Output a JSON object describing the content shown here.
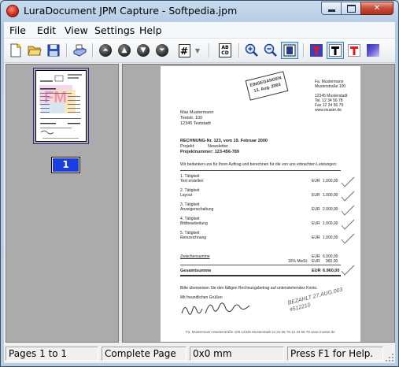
{
  "window": {
    "title": "LuraDocument JPM Capture - Softpedia.jpm"
  },
  "menu": [
    "File",
    "Edit",
    "View",
    "Settings",
    "Help"
  ],
  "toolbar": {
    "icons": [
      "new-document-icon",
      "open-folder-icon",
      "save-icon",
      "scan-icon",
      "first-page-icon",
      "previous-page-icon",
      "next-page-icon",
      "last-page-icon",
      "go-to-page-icon",
      "dropdown-arrow-icon",
      "ocr-text-icon",
      "zoom-in-icon",
      "zoom-out-icon",
      "fit-page-icon",
      "mask-layer-icon",
      "text-layer-black-icon",
      "text-layer-red-icon",
      "background-layer-icon"
    ],
    "goto_label": "#",
    "ocr_label": "AB CD"
  },
  "thumbnails": {
    "page_number": "1"
  },
  "document": {
    "sender_small": "Fa. Mustermann\nMusterstraße 100\n\n12345 Musterstadt\nTel. 12 34 56 78\nFax 12 34 56 79\nwww.muster.de",
    "stamp": "EINGEGANGEN\n13. Aug. 2003",
    "recipient": "Max Mustermann\nTeststr. 100\n12345 Teststadt",
    "invoice_title": "RECHNUNG-Nr. 123, vom 19. Februar 2000",
    "project_label": "Projekt:",
    "project_value": "Newsletter",
    "project_number": "Projektnummer:   123-456-789",
    "intro": "Wir bedanken uns für Ihren Auftrag und berechnen für die von uns erbrachten Leistungen:",
    "items": [
      {
        "title": "1. Tätigkeit",
        "desc": "Text erstellen",
        "cur": "EUR",
        "amount": "1.000,00"
      },
      {
        "title": "2. Tätigkeit",
        "desc": "Layout",
        "cur": "EUR",
        "amount": "1.000,00"
      },
      {
        "title": "3. Tätigkeit",
        "desc": "Anzeigenschaltung",
        "cur": "EUR",
        "amount": "2.000,00"
      },
      {
        "title": "4. Tätigkeit",
        "desc": "Bildbearbeitung",
        "cur": "EUR",
        "amount": "1.000,00"
      },
      {
        "title": "5. Tätigkeit",
        "desc": "Reinzeichnung",
        "cur": "EUR",
        "amount": "1.000,00"
      }
    ],
    "subtotal_label": "Zwischensumme",
    "subtotal_cur": "EUR",
    "subtotal_amount": "6.000,00",
    "vat_label": "16% MwSt.",
    "vat_cur": "EUR",
    "vat_amount": "960,00",
    "total_label": "Gesamtsumme",
    "total_cur": "EUR",
    "total_amount": "6.960,00",
    "payment_note": "Bitte überweisen Sie den fälligen Rechnungsbetrag auf untenstehendes Konto.",
    "greeting": "Mit freundlichen Grüßen",
    "paid_note": "BEZAHLT 27.AUG.003\n#512210",
    "footer": "Fa. Mustermann   Musterstraße 100   12345 Musterstadt   12 34 56 78   12 34 56 79   www.muster.de"
  },
  "status": {
    "pages": "Pages 1 to 1",
    "mode": "Complete Page",
    "size": "0x0 mm",
    "help": "Press F1 for Help."
  },
  "colors": {
    "selection_badge": "#1a3ee0",
    "pane_gray": "#ababab"
  }
}
